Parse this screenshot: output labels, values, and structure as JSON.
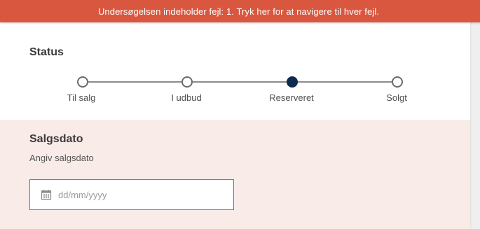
{
  "banner": {
    "text": "Undersøgelsen indeholder fejl: 1. Tryk her for at navigere til hver fejl.",
    "color": "#d9573f"
  },
  "status": {
    "title": "Status",
    "steps": [
      {
        "label": "Til salg",
        "active": false
      },
      {
        "label": "I udbud",
        "active": false
      },
      {
        "label": "Reserveret",
        "active": true
      },
      {
        "label": "Solgt",
        "active": false
      }
    ],
    "active_color": "#0d2b4f"
  },
  "sales_date": {
    "title": "Salgsdato",
    "subtitle": "Angiv salgsdato",
    "input_placeholder": "dd/mm/yyyy",
    "input_icon": "calendar-icon",
    "error_border_color": "#d5503b"
  }
}
